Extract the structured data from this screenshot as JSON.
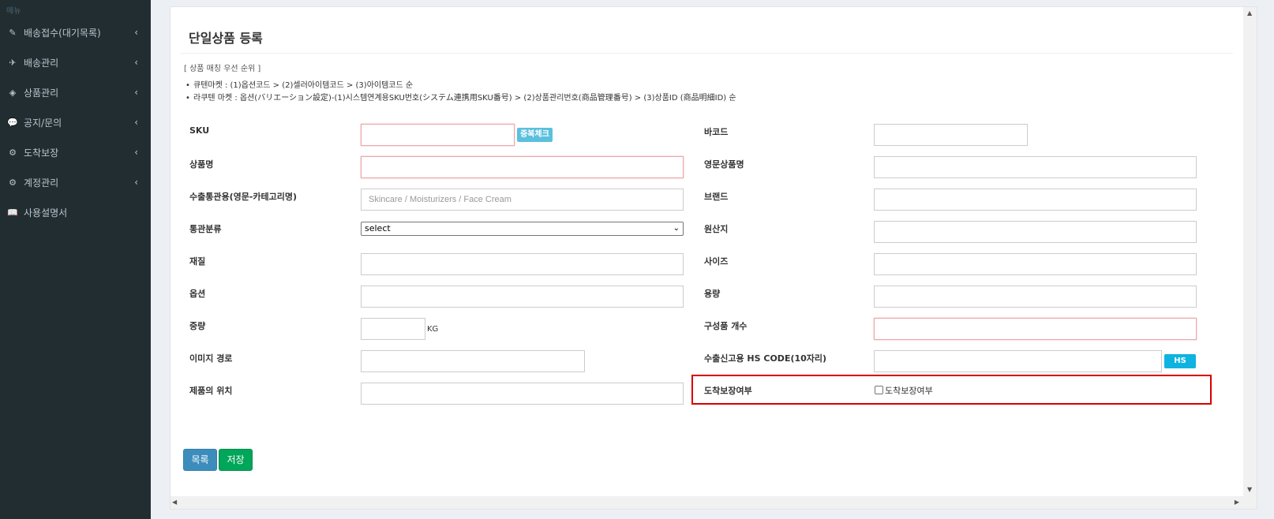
{
  "sidebar": {
    "header": "메뉴",
    "items": [
      {
        "label": "배송접수(대기목록)",
        "icon": "pencil-icon",
        "glyph": "✎",
        "chevron": "‹"
      },
      {
        "label": "배송관리",
        "icon": "plane-icon",
        "glyph": "✈",
        "chevron": "‹"
      },
      {
        "label": "상품관리",
        "icon": "cube-icon",
        "glyph": "◈",
        "chevron": "‹"
      },
      {
        "label": "공지/문의",
        "icon": "comments-icon",
        "glyph": "💬",
        "chevron": "‹"
      },
      {
        "label": "도착보장",
        "icon": "gear-icon",
        "glyph": "⚙",
        "chevron": "‹"
      },
      {
        "label": "계정관리",
        "icon": "gear-icon",
        "glyph": "⚙",
        "chevron": "‹"
      },
      {
        "label": "사용설명서",
        "icon": "book-icon",
        "glyph": "📖",
        "chevron": ""
      }
    ]
  },
  "page": {
    "title": "단일상품 등록",
    "priority_heading": "[ 상품 매칭 우선 순위 ]",
    "bullets": [
      "큐텐마켓 : (1)옵션코드 > (2)셀러아이템코드 > (3)아이템코드 순",
      "라쿠텐 마켓 : 옵션(バリエーション設定)-(1)시스템연계용SKU번호(システム連携用SKU番号) > (2)상품관리번호(商品管理番号) > (3)상품ID (商品明細ID) 순"
    ]
  },
  "form": {
    "sku_label": "SKU",
    "sku_value": "",
    "dup_check": "중복체크",
    "barcode_label": "바코드",
    "barcode_value": "",
    "name_label": "상품명",
    "name_value": "",
    "eng_name_label": "영문상품명",
    "eng_name_value": "",
    "customs_category_label": "수출통관용(영문-카테고리명)",
    "customs_category_placeholder": "Skincare / Moisturizers / Face Cream",
    "brand_label": "브랜드",
    "brand_value": "",
    "customs_class_label": "통관분류",
    "customs_class_selected": "select",
    "origin_label": "원산지",
    "origin_value": "",
    "material_label": "재질",
    "material_value": "",
    "size_label": "사이즈",
    "size_value": "",
    "option_label": "옵션",
    "option_value": "",
    "volume_label": "용량",
    "volume_value": "",
    "weight_label": "중량",
    "weight_value": "",
    "weight_unit": "KG",
    "components_label": "구성품 개수",
    "components_value": "",
    "image_path_label": "이미지 경로",
    "image_path_value": "",
    "hs_code_label": "수출신고용 HS CODE(10자리)",
    "hs_code_value": "",
    "hs_info": "HS Info",
    "location_label": "제품의 위치",
    "location_value": "",
    "arrival_label": "도착보장여부",
    "arrival_checkbox_label": "도착보장여부",
    "arrival_checked": false
  },
  "buttons": {
    "list": "목록",
    "save": "저장"
  },
  "colors": {
    "sidebar_bg": "#222d32",
    "primary": "#3c8dbc",
    "success": "#00a65a",
    "info": "#5bc0de",
    "highlight": "#d80000"
  }
}
